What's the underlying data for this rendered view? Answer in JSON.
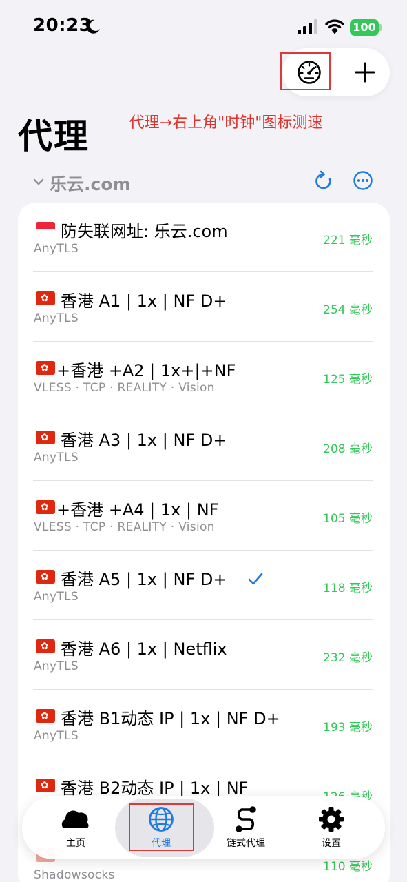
{
  "status_bar": {
    "time": "20:23",
    "battery": "100"
  },
  "page": {
    "title": "代理"
  },
  "annotation": {
    "text": "代理→右上角\"时钟\"图标测速"
  },
  "group": {
    "name": "乐云.com"
  },
  "nodes": [
    {
      "name": "防失联网址: 乐云.com",
      "protocol": "AnyTLS",
      "latency": "221 毫秒"
    },
    {
      "name": "香港 A1 | 1x | NF D+",
      "protocol": "AnyTLS",
      "latency": "254 毫秒"
    },
    {
      "name": "+香港 +A2 | 1x+|+NF",
      "protocol": "VLESS · TCP · REALITY · Vision",
      "latency": "125 毫秒"
    },
    {
      "name": "香港 A3 | 1x | NF D+",
      "protocol": "AnyTLS",
      "latency": "208 毫秒"
    },
    {
      "name": "+香港 +A4 | 1x | NF",
      "protocol": "VLESS · TCP · REALITY · Vision",
      "latency": "105 毫秒"
    },
    {
      "name": "香港 A5 | 1x | NF D+",
      "protocol": "AnyTLS",
      "latency": "118 毫秒"
    },
    {
      "name": "香港 A6 | 1x | Netflix",
      "protocol": "AnyTLS",
      "latency": "232 毫秒"
    },
    {
      "name": "香港 B1动态 IP | 1x | NF D+",
      "protocol": "AnyTLS",
      "latency": "193 毫秒"
    },
    {
      "name": "香港 B2动态 IP | 1x | NF",
      "protocol": "",
      "latency": "126 毫秒"
    },
    {
      "name": "",
      "protocol": "Shadowsocks",
      "latency": "110 毫秒"
    }
  ],
  "selected_node_index": 5,
  "tabs": [
    {
      "label": "主页",
      "icon": "cloud-icon"
    },
    {
      "label": "代理",
      "icon": "globe-icon"
    },
    {
      "label": "链式代理",
      "icon": "chain-icon"
    },
    {
      "label": "设置",
      "icon": "gear-icon"
    }
  ],
  "colors": {
    "accent": "#1e7be0",
    "latency_green": "#34c759",
    "annotation_red": "#e0332d"
  }
}
